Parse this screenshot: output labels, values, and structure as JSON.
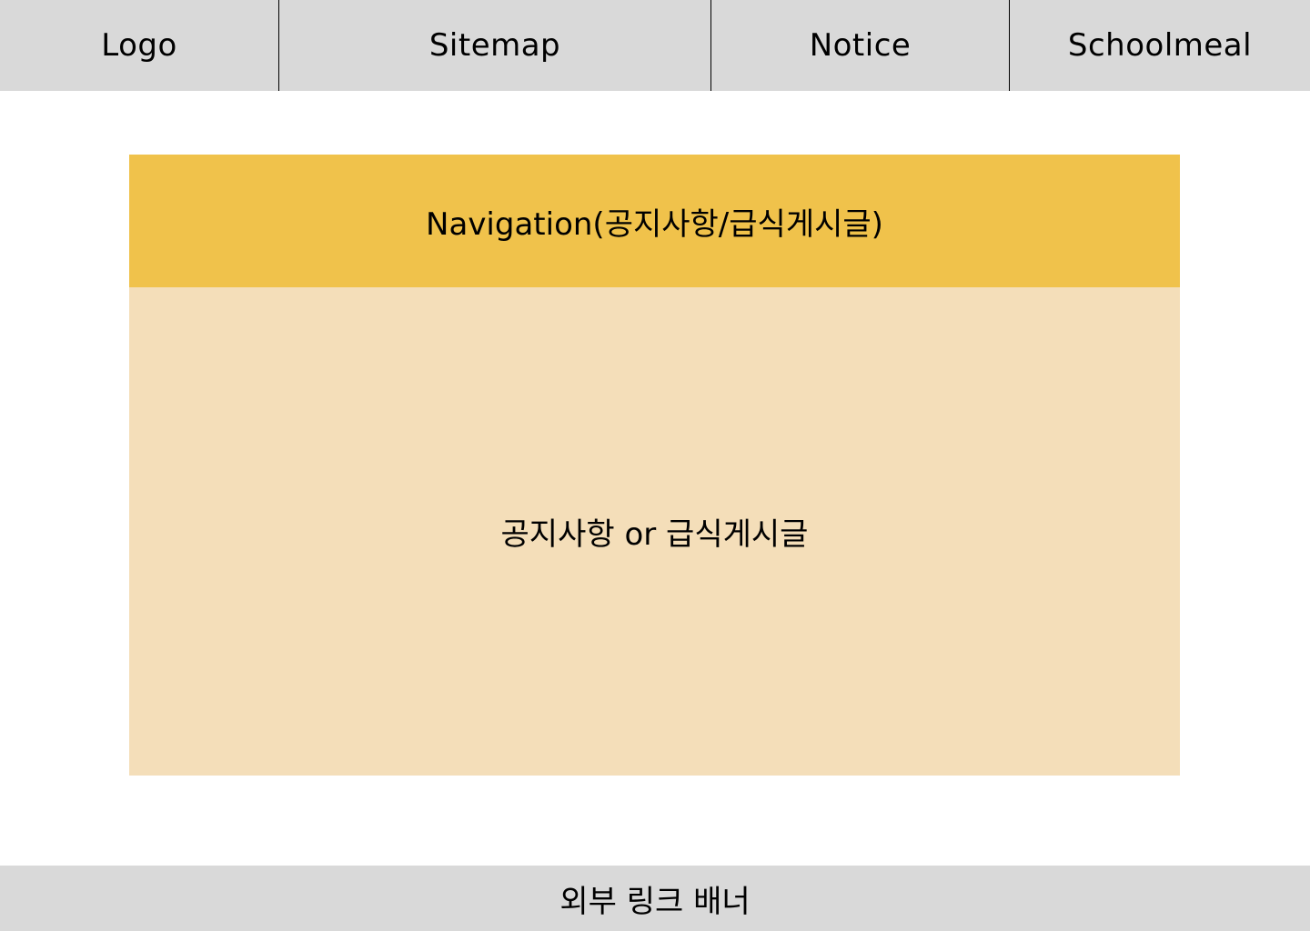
{
  "header": {
    "logo": "Logo",
    "sitemap": "Sitemap",
    "notice": "Notice",
    "schoolmeal": "Schoolmeal"
  },
  "main": {
    "navigation_label": "Navigation(공지사항/급식게시글)",
    "content_label": "공지사항 or 급식게시글"
  },
  "footer": {
    "banner_label": "외부 링크 배너"
  },
  "colors": {
    "header_bg": "#d9d9d9",
    "navigation_bg": "#f0c24b",
    "content_bg": "#f4deb9",
    "footer_bg": "#d9d9d9"
  }
}
